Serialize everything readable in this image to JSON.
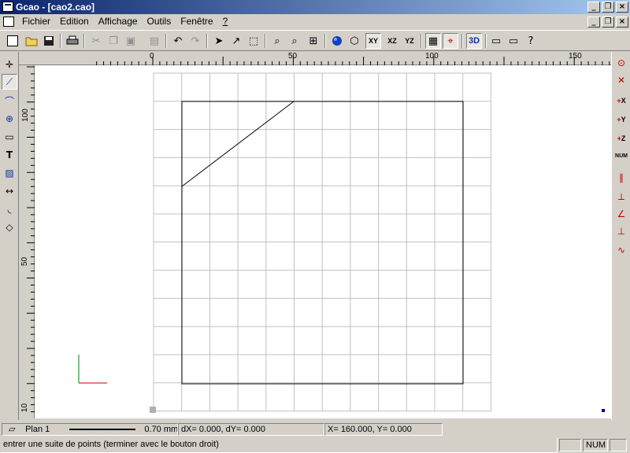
{
  "window": {
    "title": "Gcao - [cao2.cao]"
  },
  "menu": {
    "items": [
      "Fichier",
      "Edition",
      "Affichage",
      "Outils",
      "Fenêtre",
      "?"
    ]
  },
  "toolbar": {
    "icons": [
      "new-icon",
      "open-icon",
      "save-icon",
      "print-icon",
      "cut-icon",
      "copy-icon",
      "paste-icon",
      "properties-icon",
      "undo-icon",
      "redo-icon",
      "select-arrow-icon",
      "edit-node-icon",
      "select-window-icon",
      "zoom-window-icon",
      "zoom-dynamic-icon",
      "zoom-all-icon",
      "render-sphere-icon",
      "3d-box-icon",
      "view-xy-icon",
      "view-xz-icon",
      "view-yz-icon",
      "grid-snap-icon",
      "object-snap-icon",
      "3d-view-icon",
      "frame-icon",
      "frame-3d-icon",
      "help-icon"
    ],
    "view_xy": "XY",
    "view_xz": "XZ",
    "view_yz": "YZ",
    "view_3d": "3D"
  },
  "ruler": {
    "h_labels": [
      "0",
      "50",
      "100",
      "150"
    ],
    "v_labels": [
      "100",
      "50",
      "10"
    ]
  },
  "left_tools": [
    "point-tool-icon",
    "polyline-tool-icon",
    "arc-tool-icon",
    "circle-tool-icon",
    "rectangle-tool-icon",
    "text-tool-icon",
    "hatch-tool-icon",
    "dimension-tool-icon",
    "fillet-tool-icon",
    "eraser-tool-icon"
  ],
  "right_tools": [
    "snap-endpoint-icon",
    "snap-intersection-icon",
    "rel-x-icon",
    "rel-y-icon",
    "rel-z-icon",
    "rel-num-icon",
    "parallel-icon",
    "perpendicular-icon",
    "angle-icon",
    "orthogonal-icon",
    "tangent-icon"
  ],
  "right_labels": {
    "x": "X",
    "y": "Y",
    "z": "Z",
    "num": "NUM"
  },
  "status": {
    "plane": "Plan 1",
    "line_width": "0.70 mm",
    "delta": "dX=      0.000, dY=      0.000",
    "coords": "X=   160.000, Y=      0.000",
    "prompt": "entrer une suite de points (terminer avec le bouton droit)",
    "num_indicator": "NUM"
  },
  "colors": {
    "titlebar_start": "#0a246a",
    "titlebar_end": "#a6caf0",
    "grid": "#c0c0c0",
    "axis_x": "#c00000",
    "axis_y": "#008000"
  }
}
